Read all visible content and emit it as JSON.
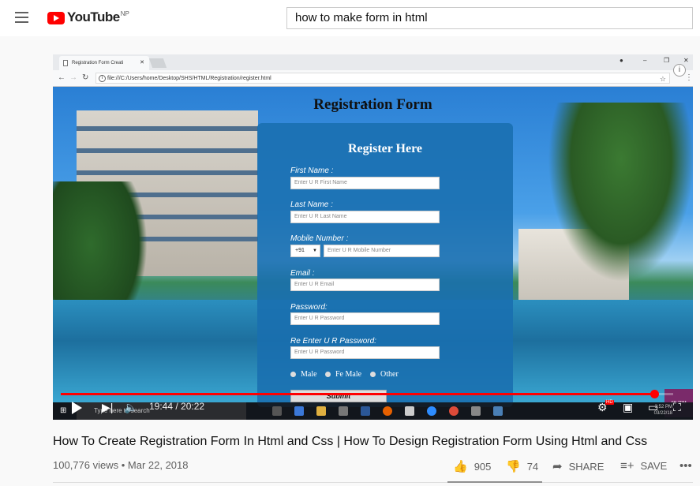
{
  "youtube": {
    "logo_text": "YouTube",
    "region": "NP",
    "search_value": "how to make form in html"
  },
  "browser": {
    "tab_title": "Registration Form Creati",
    "url": "file:///C:/Users/home/Desktop/SHS/HTML/Registration/register.html"
  },
  "form": {
    "page_title": "Registration Form",
    "heading": "Register Here",
    "fields": [
      {
        "label": "First Name :",
        "placeholder": "Enter U R First Name"
      },
      {
        "label": "Last Name :",
        "placeholder": "Enter U R Last Name"
      },
      {
        "label": "Mobile Number :",
        "placeholder": "Enter U R Mobile Number",
        "code": "+91"
      },
      {
        "label": "Email :",
        "placeholder": "Enter U R Email"
      },
      {
        "label": "Password:",
        "placeholder": "Enter U R Password"
      },
      {
        "label": "Re Enter U R Password:",
        "placeholder": "Enter U R Password"
      }
    ],
    "gender_options": [
      "Male",
      "Fe Male",
      "Other"
    ],
    "submit_label": "Submit"
  },
  "taskbar": {
    "search_placeholder": "Type here to search",
    "time": "3:52 PM",
    "date": "03/22/18"
  },
  "player": {
    "current_time": "19:44",
    "duration": "20:22",
    "time_display": "19:44 / 20:22",
    "progress_fraction": 0.969,
    "hd_badge": "HD"
  },
  "video": {
    "title": "How To Create Registration Form In Html and Css | How To Design Registration Form Using Html and Css",
    "views": "100,776 views",
    "date": "Mar 22, 2018",
    "meta": "100,776 views • Mar 22, 2018",
    "likes": "905",
    "dislikes": "74",
    "share_label": "SHARE",
    "save_label": "SAVE"
  },
  "badge_text": "SR TDM",
  "colors": {
    "youtube_red": "#ff0000",
    "form_panel": "#1e6eaf"
  }
}
